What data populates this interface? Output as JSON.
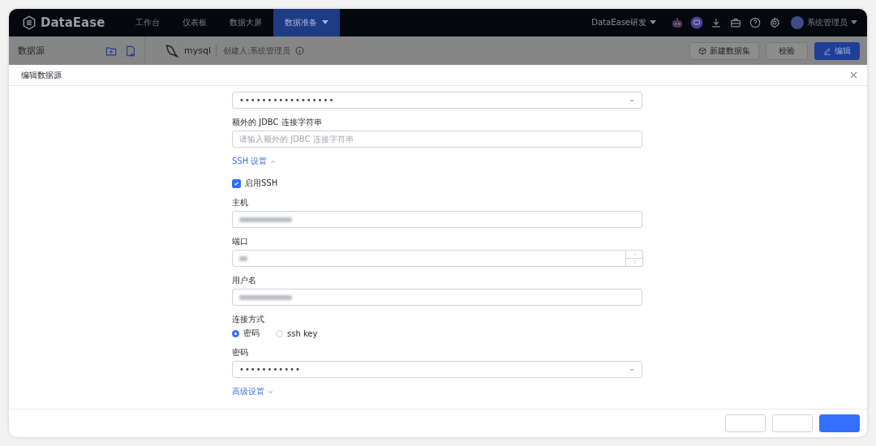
{
  "top_nav": {
    "logo": "DataEase",
    "tabs": [
      {
        "label": "工作台",
        "selected": false
      },
      {
        "label": "仪表板",
        "selected": false
      },
      {
        "label": "数据大屏",
        "selected": false
      },
      {
        "label": "数据准备",
        "selected": true
      }
    ],
    "org": "DataEase研发",
    "user": "系统管理员"
  },
  "sub_bar": {
    "title": "数据源",
    "datasource": "mysql",
    "creator": "创建人:系统管理员",
    "buttons": [
      {
        "label": "新建数据集",
        "kind": "icon"
      },
      {
        "label": "校验",
        "kind": "plain"
      },
      {
        "label": "编辑",
        "kind": "primary"
      }
    ]
  },
  "drawer": {
    "title": "编辑数据源",
    "fields": [
      {
        "kind": "select",
        "value": "•••••••••••••••••"
      },
      {
        "kind": "label",
        "text": "额外的 JDBC 连接字符串"
      },
      {
        "kind": "input",
        "placeholder": "请输入额外的 JDBC 连接字符串",
        "blurred": false
      },
      {
        "kind": "toggle",
        "text": "SSH 设置",
        "expanded": true
      },
      {
        "kind": "checkbox",
        "text": "启用SSH",
        "checked": true
      },
      {
        "kind": "label",
        "text": "主机"
      },
      {
        "kind": "input",
        "blurred": true
      },
      {
        "kind": "label",
        "text": "端口"
      },
      {
        "kind": "number",
        "blurred": true
      },
      {
        "kind": "label",
        "text": "用户名"
      },
      {
        "kind": "input",
        "blurred": true
      },
      {
        "kind": "label",
        "text": "连接方式"
      },
      {
        "kind": "radio",
        "options": [
          {
            "label": "密码",
            "selected": true
          },
          {
            "label": "ssh key",
            "selected": false
          }
        ]
      },
      {
        "kind": "label",
        "text": "密码"
      },
      {
        "kind": "select",
        "value": "•••••••••••"
      },
      {
        "kind": "toggle",
        "text": "高级设置",
        "expanded": false
      }
    ]
  }
}
